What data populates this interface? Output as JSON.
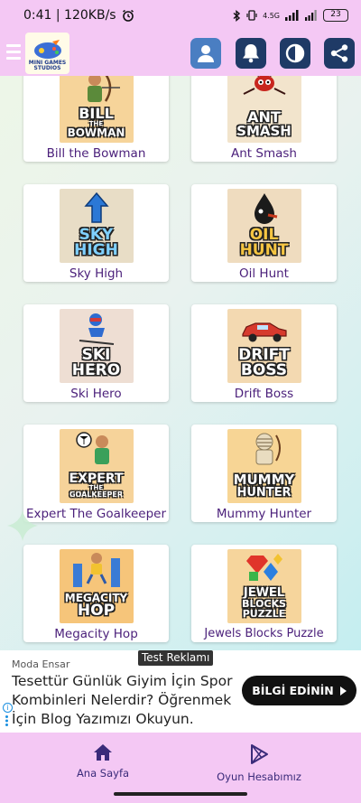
{
  "status_bar": {
    "time_speed": "0:41 | 120KB/s",
    "network": "4.5G",
    "battery": "23"
  },
  "app_bar": {
    "logo_text_1": "MINI GAMES",
    "logo_text_2": "STUDIOS",
    "icons": [
      "menu-icon",
      "profile-icon",
      "bell-icon",
      "theme-icon",
      "share-icon"
    ],
    "button_color": "#3f6fb0"
  },
  "games": [
    {
      "name": "Bill the Bowman",
      "thumb_top": "BILL",
      "thumb_mid": "THE",
      "thumb_bottom": "BOWMAN",
      "bg": "#f6d49a"
    },
    {
      "name": "Ant Smash",
      "thumb_top": "ANT",
      "thumb_bottom": "SMASH",
      "bg": "#f2e4cc"
    },
    {
      "name": "Sky High",
      "thumb_top": "SKY",
      "thumb_bottom": "HIGH",
      "bg": "#e8ddc6"
    },
    {
      "name": "Oil Hunt",
      "thumb_top": "OIL",
      "thumb_bottom": "HUNT",
      "bg": "#efdcbf"
    },
    {
      "name": "Ski Hero",
      "thumb_top": "SKI",
      "thumb_bottom": "HERO",
      "bg": "#eeded3"
    },
    {
      "name": "Drift Boss",
      "thumb_top": "DRIFT",
      "thumb_bottom": "BOSS",
      "bg": "#f3d9b1"
    },
    {
      "name": "Expert The Goalkeeper",
      "thumb_top": "EXPERT",
      "thumb_mid": "THE",
      "thumb_bottom": "GOALKEEPER",
      "bg": "#f6d39a"
    },
    {
      "name": "Mummy Hunter",
      "thumb_top": "MUMMY",
      "thumb_bottom": "HUNTER",
      "bg": "#f7d595"
    },
    {
      "name": "Megacity Hop",
      "thumb_top": "MEGACITY",
      "thumb_bottom": "HOP",
      "bg": "#f6c57a"
    },
    {
      "name": "Jewels Blocks Puzzle",
      "thumb_top": "JEWEL",
      "thumb_mid": "BLOCKS",
      "thumb_bottom": "PUZZLE",
      "bg": "#f6d59c"
    }
  ],
  "ad": {
    "tag": "Test Reklamı",
    "brand": "Moda Ensar",
    "text": "Tesettür Günlük Giyim İçin Spor Kombinleri Nelerdir? Öğrenmek İçin Blog Yazımızı Okuyun.",
    "cta": "BİLGİ EDİNİN"
  },
  "bottom_nav": {
    "home_label": "Ana Sayfa",
    "account_label": "Oyun Hesabımız",
    "accent": "#3a2b7a"
  }
}
